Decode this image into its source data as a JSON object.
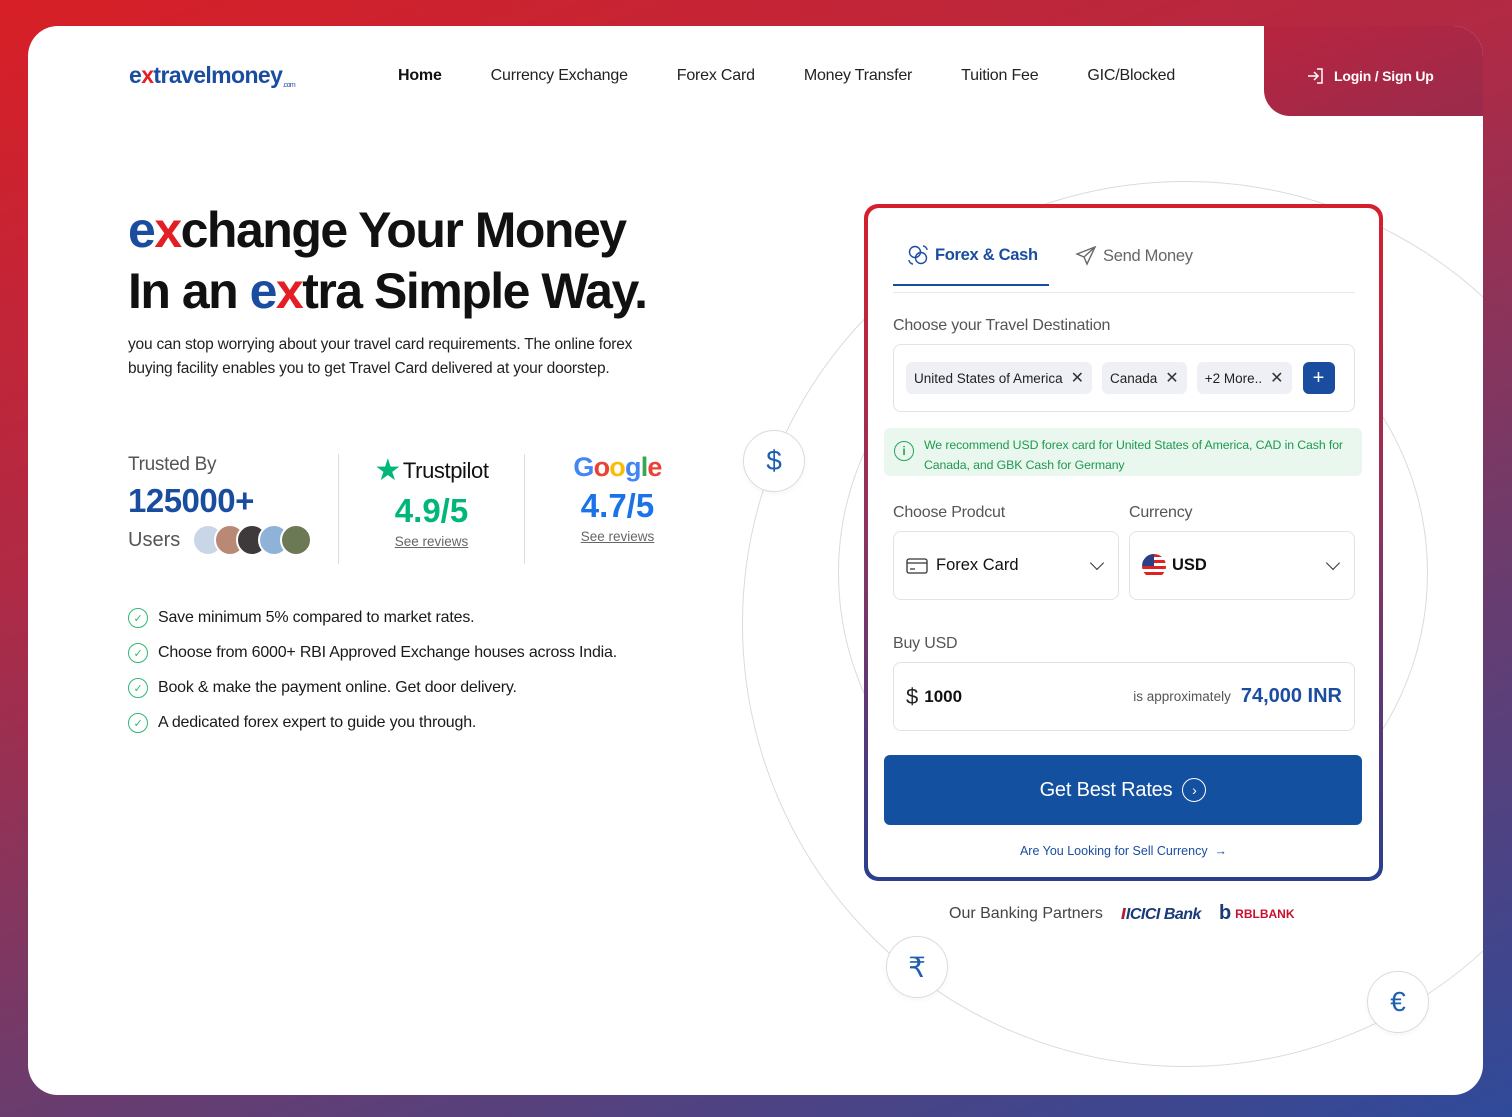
{
  "brand": {
    "logo_pre": "e",
    "logo_x": "x",
    "logo_rest": "travelmoney",
    "logo_tld": ".com"
  },
  "nav": {
    "items": [
      "Home",
      "Currency Exchange",
      "Forex Card",
      "Money Transfer",
      "Tuition Fee",
      "GIC/Blocked"
    ],
    "login_label": "Login / Sign Up"
  },
  "hero": {
    "line1_ex": "e",
    "line1_x": "x",
    "line1_rest": "change Your Money",
    "line2_pre": "In an ",
    "line2_ex": "e",
    "line2_x": "x",
    "line2_rest": "tra Simple Way.",
    "description": " you can stop worrying about your travel card requirements. The online forex buying facility enables you to get Travel Card delivered at your doorstep."
  },
  "stats": {
    "trusted_label": "Trusted By",
    "users_count": "125000+",
    "users_label": "Users",
    "trustpilot_brand": "Trustpilot",
    "trustpilot_rating": "4.9/5",
    "google_brand": "Google",
    "google_rating": "4.7/5",
    "see_reviews": "See reviews"
  },
  "features": [
    "Save minimum 5% compared to market rates.",
    "Choose from 6000+ RBI Approved Exchange houses across India.",
    "Book & make the payment online. Get door delivery.",
    "A dedicated forex expert to guide you through."
  ],
  "card": {
    "tab_active": "Forex & Cash",
    "tab_inactive": "Send Money",
    "destination_label": "Choose your Travel Destination",
    "chips": [
      "United States of America",
      "Canada",
      "+2 More.."
    ],
    "recommendation": "We recommend USD forex card for United States of America, CAD in Cash for Canada, and GBK Cash for Germany",
    "product_label": "Choose Prodcut",
    "product_value": "Forex Card",
    "currency_label": "Currency",
    "currency_value": "USD",
    "buy_label": "Buy USD",
    "amount": "1000",
    "approx_label": "is approximately",
    "inr_value": "74,000 INR",
    "cta_label": "Get Best Rates",
    "sell_link": "Are You Looking for Sell Currency"
  },
  "partners": {
    "label": "Our Banking Partners",
    "icici": "ICICI Bank",
    "rbl": "RBLBANK"
  },
  "coins": {
    "dollar": "$",
    "rupee": "₹",
    "euro": "€"
  },
  "colors": {
    "brand_blue": "#1a4da0",
    "brand_red": "#e31e24",
    "trustpilot_green": "#00b67a",
    "google_blue": "#1a73e8",
    "success_green": "#2eb872"
  }
}
